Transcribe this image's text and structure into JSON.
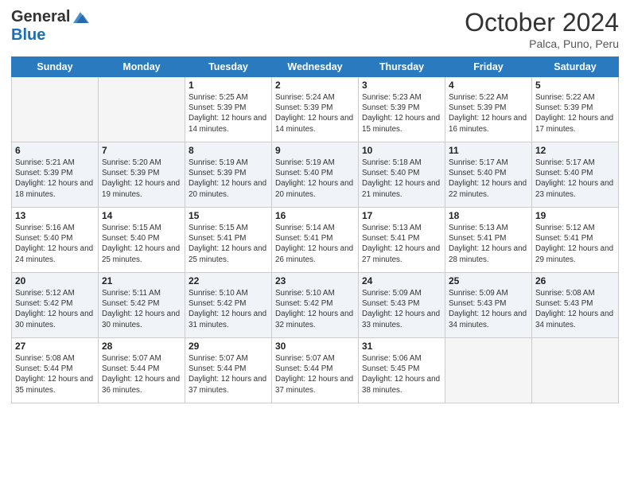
{
  "header": {
    "logo": {
      "general": "General",
      "blue": "Blue"
    },
    "title": "October 2024",
    "location": "Palca, Puno, Peru"
  },
  "days_of_week": [
    "Sunday",
    "Monday",
    "Tuesday",
    "Wednesday",
    "Thursday",
    "Friday",
    "Saturday"
  ],
  "weeks": [
    [
      {
        "day": "",
        "sunrise": "",
        "sunset": "",
        "daylight": "",
        "empty": true
      },
      {
        "day": "",
        "sunrise": "",
        "sunset": "",
        "daylight": "",
        "empty": true
      },
      {
        "day": "1",
        "sunrise": "Sunrise: 5:25 AM",
        "sunset": "Sunset: 5:39 PM",
        "daylight": "Daylight: 12 hours and 14 minutes.",
        "empty": false
      },
      {
        "day": "2",
        "sunrise": "Sunrise: 5:24 AM",
        "sunset": "Sunset: 5:39 PM",
        "daylight": "Daylight: 12 hours and 14 minutes.",
        "empty": false
      },
      {
        "day": "3",
        "sunrise": "Sunrise: 5:23 AM",
        "sunset": "Sunset: 5:39 PM",
        "daylight": "Daylight: 12 hours and 15 minutes.",
        "empty": false
      },
      {
        "day": "4",
        "sunrise": "Sunrise: 5:22 AM",
        "sunset": "Sunset: 5:39 PM",
        "daylight": "Daylight: 12 hours and 16 minutes.",
        "empty": false
      },
      {
        "day": "5",
        "sunrise": "Sunrise: 5:22 AM",
        "sunset": "Sunset: 5:39 PM",
        "daylight": "Daylight: 12 hours and 17 minutes.",
        "empty": false
      }
    ],
    [
      {
        "day": "6",
        "sunrise": "Sunrise: 5:21 AM",
        "sunset": "Sunset: 5:39 PM",
        "daylight": "Daylight: 12 hours and 18 minutes.",
        "empty": false
      },
      {
        "day": "7",
        "sunrise": "Sunrise: 5:20 AM",
        "sunset": "Sunset: 5:39 PM",
        "daylight": "Daylight: 12 hours and 19 minutes.",
        "empty": false
      },
      {
        "day": "8",
        "sunrise": "Sunrise: 5:19 AM",
        "sunset": "Sunset: 5:39 PM",
        "daylight": "Daylight: 12 hours and 20 minutes.",
        "empty": false
      },
      {
        "day": "9",
        "sunrise": "Sunrise: 5:19 AM",
        "sunset": "Sunset: 5:40 PM",
        "daylight": "Daylight: 12 hours and 20 minutes.",
        "empty": false
      },
      {
        "day": "10",
        "sunrise": "Sunrise: 5:18 AM",
        "sunset": "Sunset: 5:40 PM",
        "daylight": "Daylight: 12 hours and 21 minutes.",
        "empty": false
      },
      {
        "day": "11",
        "sunrise": "Sunrise: 5:17 AM",
        "sunset": "Sunset: 5:40 PM",
        "daylight": "Daylight: 12 hours and 22 minutes.",
        "empty": false
      },
      {
        "day": "12",
        "sunrise": "Sunrise: 5:17 AM",
        "sunset": "Sunset: 5:40 PM",
        "daylight": "Daylight: 12 hours and 23 minutes.",
        "empty": false
      }
    ],
    [
      {
        "day": "13",
        "sunrise": "Sunrise: 5:16 AM",
        "sunset": "Sunset: 5:40 PM",
        "daylight": "Daylight: 12 hours and 24 minutes.",
        "empty": false
      },
      {
        "day": "14",
        "sunrise": "Sunrise: 5:15 AM",
        "sunset": "Sunset: 5:40 PM",
        "daylight": "Daylight: 12 hours and 25 minutes.",
        "empty": false
      },
      {
        "day": "15",
        "sunrise": "Sunrise: 5:15 AM",
        "sunset": "Sunset: 5:41 PM",
        "daylight": "Daylight: 12 hours and 25 minutes.",
        "empty": false
      },
      {
        "day": "16",
        "sunrise": "Sunrise: 5:14 AM",
        "sunset": "Sunset: 5:41 PM",
        "daylight": "Daylight: 12 hours and 26 minutes.",
        "empty": false
      },
      {
        "day": "17",
        "sunrise": "Sunrise: 5:13 AM",
        "sunset": "Sunset: 5:41 PM",
        "daylight": "Daylight: 12 hours and 27 minutes.",
        "empty": false
      },
      {
        "day": "18",
        "sunrise": "Sunrise: 5:13 AM",
        "sunset": "Sunset: 5:41 PM",
        "daylight": "Daylight: 12 hours and 28 minutes.",
        "empty": false
      },
      {
        "day": "19",
        "sunrise": "Sunrise: 5:12 AM",
        "sunset": "Sunset: 5:41 PM",
        "daylight": "Daylight: 12 hours and 29 minutes.",
        "empty": false
      }
    ],
    [
      {
        "day": "20",
        "sunrise": "Sunrise: 5:12 AM",
        "sunset": "Sunset: 5:42 PM",
        "daylight": "Daylight: 12 hours and 30 minutes.",
        "empty": false
      },
      {
        "day": "21",
        "sunrise": "Sunrise: 5:11 AM",
        "sunset": "Sunset: 5:42 PM",
        "daylight": "Daylight: 12 hours and 30 minutes.",
        "empty": false
      },
      {
        "day": "22",
        "sunrise": "Sunrise: 5:10 AM",
        "sunset": "Sunset: 5:42 PM",
        "daylight": "Daylight: 12 hours and 31 minutes.",
        "empty": false
      },
      {
        "day": "23",
        "sunrise": "Sunrise: 5:10 AM",
        "sunset": "Sunset: 5:42 PM",
        "daylight": "Daylight: 12 hours and 32 minutes.",
        "empty": false
      },
      {
        "day": "24",
        "sunrise": "Sunrise: 5:09 AM",
        "sunset": "Sunset: 5:43 PM",
        "daylight": "Daylight: 12 hours and 33 minutes.",
        "empty": false
      },
      {
        "day": "25",
        "sunrise": "Sunrise: 5:09 AM",
        "sunset": "Sunset: 5:43 PM",
        "daylight": "Daylight: 12 hours and 34 minutes.",
        "empty": false
      },
      {
        "day": "26",
        "sunrise": "Sunrise: 5:08 AM",
        "sunset": "Sunset: 5:43 PM",
        "daylight": "Daylight: 12 hours and 34 minutes.",
        "empty": false
      }
    ],
    [
      {
        "day": "27",
        "sunrise": "Sunrise: 5:08 AM",
        "sunset": "Sunset: 5:44 PM",
        "daylight": "Daylight: 12 hours and 35 minutes.",
        "empty": false
      },
      {
        "day": "28",
        "sunrise": "Sunrise: 5:07 AM",
        "sunset": "Sunset: 5:44 PM",
        "daylight": "Daylight: 12 hours and 36 minutes.",
        "empty": false
      },
      {
        "day": "29",
        "sunrise": "Sunrise: 5:07 AM",
        "sunset": "Sunset: 5:44 PM",
        "daylight": "Daylight: 12 hours and 37 minutes.",
        "empty": false
      },
      {
        "day": "30",
        "sunrise": "Sunrise: 5:07 AM",
        "sunset": "Sunset: 5:44 PM",
        "daylight": "Daylight: 12 hours and 37 minutes.",
        "empty": false
      },
      {
        "day": "31",
        "sunrise": "Sunrise: 5:06 AM",
        "sunset": "Sunset: 5:45 PM",
        "daylight": "Daylight: 12 hours and 38 minutes.",
        "empty": false
      },
      {
        "day": "",
        "sunrise": "",
        "sunset": "",
        "daylight": "",
        "empty": true
      },
      {
        "day": "",
        "sunrise": "",
        "sunset": "",
        "daylight": "",
        "empty": true
      }
    ]
  ]
}
